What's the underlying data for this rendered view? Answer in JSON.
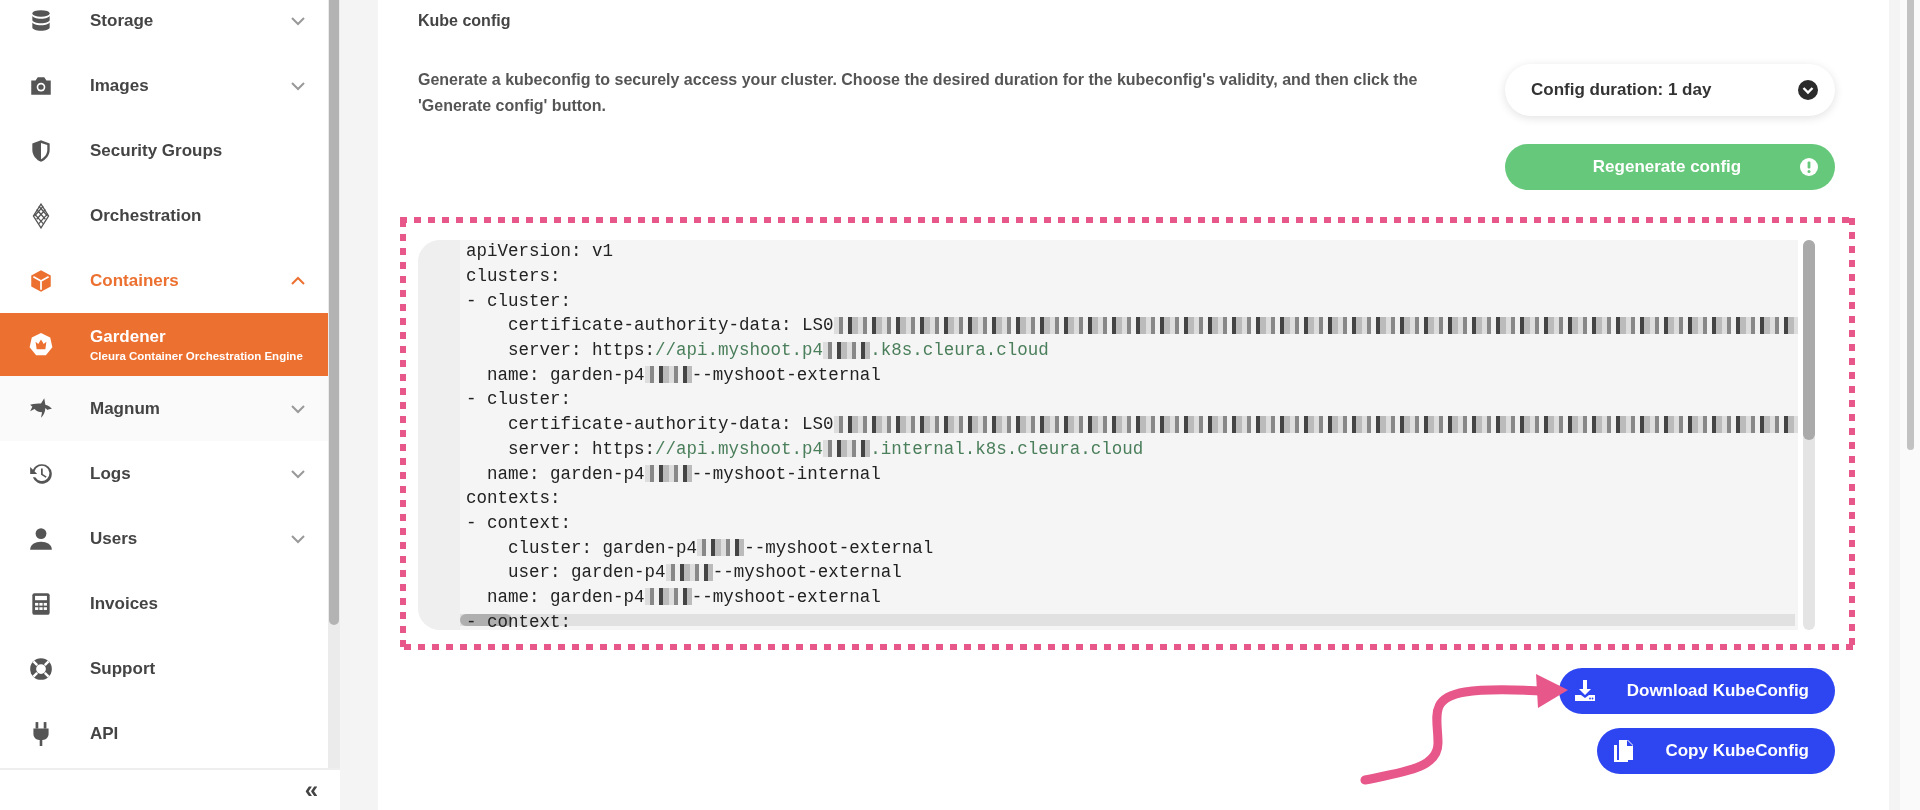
{
  "sidebar": {
    "items": [
      {
        "label": "Storage",
        "kind": "group",
        "expanded": false,
        "selected": false,
        "active": false
      },
      {
        "label": "Images",
        "kind": "group",
        "expanded": false,
        "selected": false,
        "active": false
      },
      {
        "label": "Security Groups",
        "kind": "link",
        "selected": false,
        "active": false
      },
      {
        "label": "Orchestration",
        "kind": "link",
        "selected": false,
        "active": false
      },
      {
        "label": "Containers",
        "kind": "group",
        "expanded": true,
        "selected": false,
        "active": true,
        "children": [
          {
            "label": "Gardener",
            "subtitle": "Cleura Container Orchestration Engine",
            "kind": "link",
            "selected": true,
            "active": false
          },
          {
            "label": "Magnum",
            "kind": "group",
            "expanded": false,
            "selected": false,
            "active": false
          }
        ]
      },
      {
        "label": "Logs",
        "kind": "group",
        "expanded": false,
        "selected": false,
        "active": false
      },
      {
        "label": "Users",
        "kind": "group",
        "expanded": false,
        "selected": false,
        "active": false
      },
      {
        "label": "Invoices",
        "kind": "link",
        "selected": false,
        "active": false
      },
      {
        "label": "Support",
        "kind": "link",
        "selected": false,
        "active": false
      },
      {
        "label": "API",
        "kind": "link",
        "selected": false,
        "active": false
      }
    ],
    "collapse_button": "«"
  },
  "section": {
    "title": "Kube config",
    "description": "Generate a kubeconfig to securely access your cluster. Choose the desired duration for the kubeconfig's validity, and then click the 'Generate config' button.",
    "duration_dropdown": "Config duration: 1 day",
    "regenerate_button": "Regenerate config",
    "code_lines": [
      {
        "segments": [
          {
            "kind": "text",
            "text": "apiVersion: v1"
          }
        ]
      },
      {
        "segments": [
          {
            "kind": "text",
            "text": "clusters:"
          }
        ]
      },
      {
        "segments": [
          {
            "kind": "text",
            "text": "- cluster:"
          }
        ]
      },
      {
        "segments": [
          {
            "kind": "text",
            "text": "    certificate-authority-data: LS0"
          },
          {
            "kind": "redacted"
          }
        ]
      },
      {
        "segments": [
          {
            "kind": "text",
            "text": "    server: https:"
          },
          {
            "kind": "url",
            "text": "//api.myshoot.p4"
          },
          {
            "kind": "redacted"
          },
          {
            "kind": "url",
            "text": ".k8s.cleura.cloud"
          }
        ]
      },
      {
        "segments": [
          {
            "kind": "text",
            "text": "  name: garden-p4"
          },
          {
            "kind": "redacted"
          },
          {
            "kind": "text",
            "text": "--myshoot-external"
          }
        ]
      },
      {
        "segments": [
          {
            "kind": "text",
            "text": "- cluster:"
          }
        ]
      },
      {
        "segments": [
          {
            "kind": "text",
            "text": "    certificate-authority-data: LS0"
          },
          {
            "kind": "redacted"
          }
        ]
      },
      {
        "segments": [
          {
            "kind": "text",
            "text": "    server: https:"
          },
          {
            "kind": "url",
            "text": "//api.myshoot.p4"
          },
          {
            "kind": "redacted"
          },
          {
            "kind": "url",
            "text": ".internal.k8s.cleura.cloud"
          }
        ]
      },
      {
        "segments": [
          {
            "kind": "text",
            "text": "  name: garden-p4"
          },
          {
            "kind": "redacted"
          },
          {
            "kind": "text",
            "text": "--myshoot-internal"
          }
        ]
      },
      {
        "segments": [
          {
            "kind": "text",
            "text": "contexts:"
          }
        ]
      },
      {
        "segments": [
          {
            "kind": "text",
            "text": "- context:"
          }
        ]
      },
      {
        "segments": [
          {
            "kind": "text",
            "text": "    cluster: garden-p4"
          },
          {
            "kind": "redacted"
          },
          {
            "kind": "text",
            "text": "--myshoot-external"
          }
        ]
      },
      {
        "segments": [
          {
            "kind": "text",
            "text": "    user: garden-p4"
          },
          {
            "kind": "redacted"
          },
          {
            "kind": "text",
            "text": "--myshoot-external"
          }
        ]
      },
      {
        "segments": [
          {
            "kind": "text",
            "text": "  name: garden-p4"
          },
          {
            "kind": "redacted"
          },
          {
            "kind": "text",
            "text": "--myshoot-external"
          }
        ]
      },
      {
        "segments": [
          {
            "kind": "text",
            "text": "- context:"
          }
        ]
      }
    ],
    "download_button": "Download KubeConfig",
    "copy_button": "Copy KubeConfig"
  }
}
